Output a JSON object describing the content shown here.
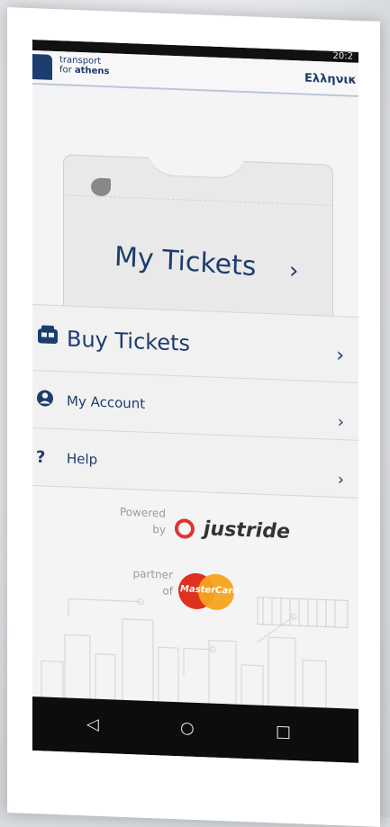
{
  "header": {
    "logo_line1": "transport",
    "logo_line2_prefix": "for ",
    "logo_line2_bold": "athens",
    "language": "Ελληνικ",
    "status_time": "20:2"
  },
  "ticket_card": {
    "title": "My Tickets",
    "chevron": "›"
  },
  "menu": {
    "items": [
      {
        "label": "Buy Tickets",
        "icon": "bus-icon",
        "chevron": "›"
      },
      {
        "label": "My Account",
        "icon": "user-icon",
        "chevron": "›"
      },
      {
        "label": "Help",
        "icon": "question-icon",
        "chevron": "›"
      }
    ]
  },
  "footer": {
    "powered_line1": "Powered",
    "powered_line2": "by",
    "powered_brand": "justride",
    "partner_line1": "partner",
    "partner_line2": "of",
    "partner_brand": "MasterCard"
  },
  "navbar": {
    "back": "◁",
    "home": "○",
    "recents": "□"
  },
  "colors": {
    "primary": "#1c3d6e",
    "justride_red": "#e23232",
    "mastercard_red": "#e0301e",
    "mastercard_orange": "#f6a31c"
  }
}
